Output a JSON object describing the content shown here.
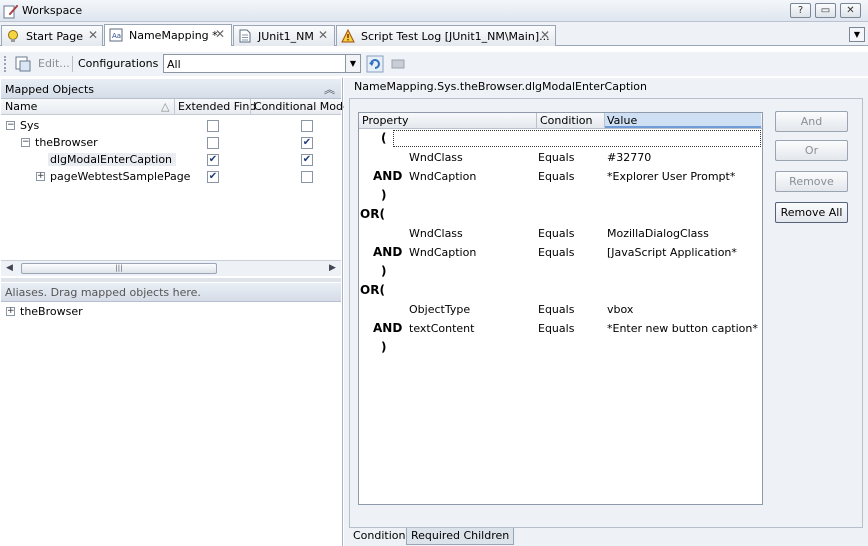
{
  "window": {
    "title": "Workspace",
    "controls": [
      "?",
      "▭",
      "✕"
    ]
  },
  "tabs": [
    {
      "label": "Start Page",
      "icon": "lightbulb-icon",
      "active": false
    },
    {
      "label": "NameMapping *",
      "icon": "name-mapping-icon",
      "active": true
    },
    {
      "label": "JUnit1_NM",
      "icon": "document-icon",
      "active": false
    },
    {
      "label": "Script Test Log [JUnit1_NM\\Main]...",
      "icon": "log-warning-icon",
      "active": false
    }
  ],
  "toolbar": {
    "edit_label": "Edit...",
    "configurations_label": "Configurations",
    "configuration_value": "All"
  },
  "mapped_objects": {
    "title": "Mapped Objects",
    "columns": [
      "Name",
      "Extended Find",
      "Conditional Mode"
    ],
    "rows": [
      {
        "name": "Sys",
        "level": 0,
        "expander": "−",
        "extended": false,
        "conditional": false
      },
      {
        "name": "theBrowser",
        "level": 1,
        "expander": "−",
        "extended": false,
        "conditional": true
      },
      {
        "name": "dlgModalEnterCaption",
        "level": 2,
        "expander": "",
        "extended": true,
        "conditional": true,
        "selected": true
      },
      {
        "name": "pageWebtestSamplePage",
        "level": 2,
        "expander": "+",
        "extended": true,
        "conditional": false
      }
    ]
  },
  "aliases": {
    "hint": "Aliases. Drag mapped objects here.",
    "items": [
      {
        "name": "theBrowser",
        "expander": "+"
      }
    ]
  },
  "details": {
    "path": "NameMapping.Sys.theBrowser.dlgModalEnterCaption",
    "columns": [
      "Property",
      "Condition",
      "Value"
    ],
    "rows": [
      {
        "kind": "open",
        "paren": "("
      },
      {
        "kind": "cond",
        "op": "",
        "property": "WndClass",
        "condition": "Equals",
        "value": "#32770"
      },
      {
        "kind": "cond",
        "op": "AND",
        "property": "WndCaption",
        "condition": "Equals",
        "value": "*Explorer User Prompt*"
      },
      {
        "kind": "close",
        "paren": ")"
      },
      {
        "kind": "or",
        "text": "OR("
      },
      {
        "kind": "cond",
        "op": "",
        "property": "WndClass",
        "condition": "Equals",
        "value": "MozillaDialogClass"
      },
      {
        "kind": "cond",
        "op": "AND",
        "property": "WndCaption",
        "condition": "Equals",
        "value": "[JavaScript Application*"
      },
      {
        "kind": "close",
        "paren": ")"
      },
      {
        "kind": "or",
        "text": "OR("
      },
      {
        "kind": "cond",
        "op": "",
        "property": "ObjectType",
        "condition": "Equals",
        "value": "vbox"
      },
      {
        "kind": "cond",
        "op": "AND",
        "property": "textContent",
        "condition": "Equals",
        "value": "*Enter new button caption*"
      },
      {
        "kind": "close",
        "paren": ")"
      }
    ],
    "buttons": {
      "and": "And",
      "or": "Or",
      "remove": "Remove",
      "remove_all": "Remove All"
    },
    "bottom_tabs": [
      "Condition",
      "Required Children"
    ]
  }
}
